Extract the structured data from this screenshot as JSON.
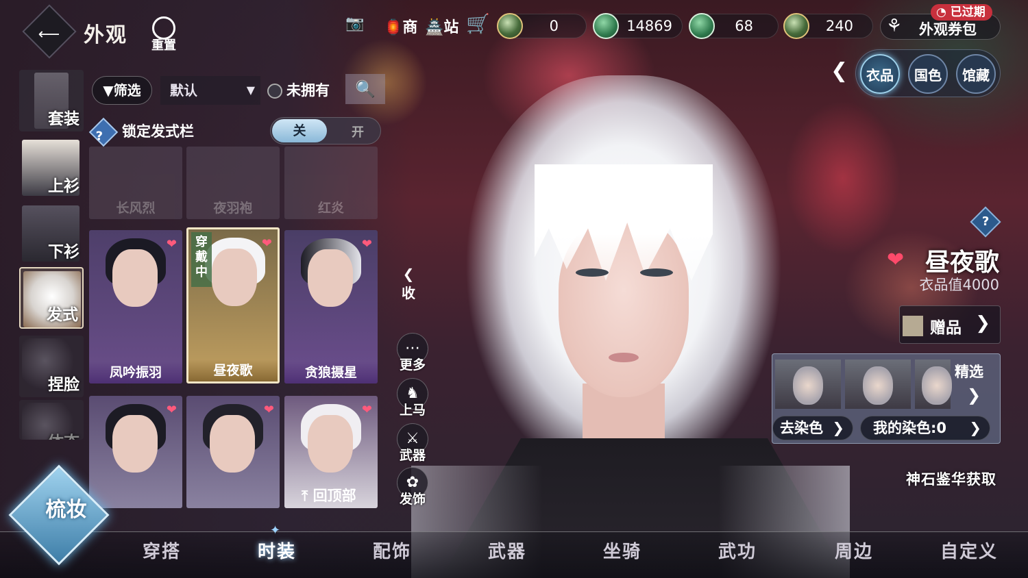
{
  "header": {
    "title": "外观",
    "reset_label": "重置",
    "icons": [
      {
        "name": "camera-icon",
        "glyph": "📷"
      },
      {
        "name": "shop-icon",
        "glyph": "商"
      },
      {
        "name": "station-icon",
        "glyph": "站"
      },
      {
        "name": "cart-icon",
        "glyph": "🛒"
      }
    ],
    "currencies": [
      "0",
      "14869",
      "68",
      "240"
    ],
    "voucher_label": "外观券包",
    "expired_badge": "已过期"
  },
  "right_tabs": {
    "items": [
      "衣品",
      "国色",
      "馆藏"
    ],
    "active": 0
  },
  "categories": [
    "套装",
    "上衫",
    "下衫",
    "发式",
    "捏脸",
    "体态"
  ],
  "filter": {
    "filter_label": "筛选",
    "sort_value": "默认",
    "unowned_label": "未拥有"
  },
  "lock": {
    "label": "锁定发式栏",
    "off_label": "关",
    "on_label": "开"
  },
  "items_dim": [
    "长风烈",
    "夜羽袍",
    "红炎"
  ],
  "items": [
    {
      "name": "凤吟振羽"
    },
    {
      "name": "昼夜歌",
      "wearing": "穿戴中"
    },
    {
      "name": "贪狼摄星"
    },
    {
      "name": ""
    },
    {
      "name": ""
    },
    {
      "name": ""
    }
  ],
  "back_top_label": "回顶部",
  "side_actions": {
    "collapse": "收",
    "more": "更多",
    "mount": "上马",
    "weapon": "武器",
    "hair_accessory": "发饰"
  },
  "detail": {
    "name": "昼夜歌",
    "value": "衣品值4000",
    "gift_label": "赠品",
    "featured": "精选",
    "remove_dye": "去染色",
    "my_dye": "我的染色:0",
    "source": "神石鉴华获取"
  },
  "makeup_label": "梳妆",
  "bottom_nav": {
    "items": [
      "穿搭",
      "时装",
      "配饰",
      "武器",
      "坐骑",
      "武功",
      "周边",
      "自定义"
    ],
    "active": 1
  },
  "colors": {
    "accent": "#9ed4ff",
    "heart": "#ff5a7c",
    "expired": "#c8303d"
  }
}
